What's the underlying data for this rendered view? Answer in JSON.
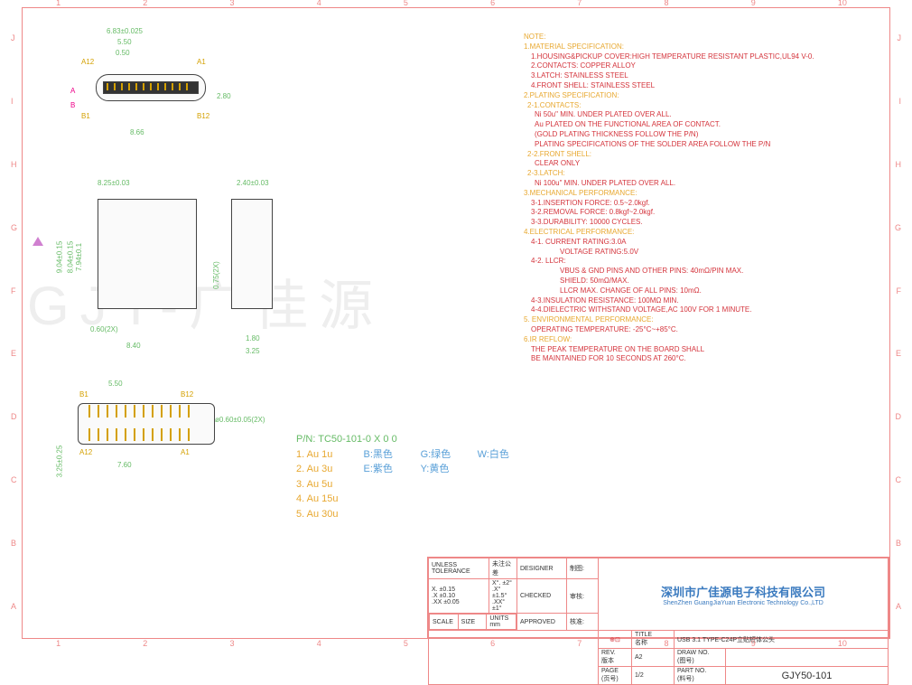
{
  "grid": {
    "cols": [
      "1",
      "2",
      "3",
      "4",
      "5",
      "6",
      "7",
      "8",
      "9",
      "10"
    ],
    "rows": [
      "J",
      "I",
      "H",
      "G",
      "F",
      "E",
      "D",
      "C",
      "B",
      "A"
    ]
  },
  "dims": {
    "d1": "6.83±0.025",
    "d2": "5.50",
    "d3": "0.50",
    "d4": "8.66",
    "d5": "2.80",
    "d6": "8.25±0.03",
    "d7": "2.40±0.03",
    "d8": "9.04±0.15",
    "d9": "8.04±0.15",
    "d10": "7.94±0.1",
    "d11": "0.60(2X)",
    "d12": "8.40",
    "d13": "0.75(2X)",
    "d14": "1.80",
    "d15": "3.25",
    "d16": "5.50",
    "d17": "ø0.60±0.05(2X)",
    "d18": "7.60",
    "d19": "3.25±0.25",
    "a1": "A1",
    "a12": "A12",
    "b1": "B1",
    "b12": "B12",
    "aA": "A",
    "aB": "B"
  },
  "notes": {
    "title": "NOTE:",
    "s1": "1.MATERIAL SPECIFICATION:",
    "s1_1": "1.HOUSING&PICKUP COVER:HIGH TEMPERATURE RESISTANT PLASTIC,UL94 V-0.",
    "s1_2": "2.CONTACTS: COPPER ALLOY",
    "s1_3": "3.LATCH: STAINLESS STEEL",
    "s1_4": "4.FRONT SHELL: STAINLESS STEEL",
    "s2": "2.PLATING SPECIFICATION:",
    "s2_1": "2-1.CONTACTS:",
    "s2_1a": "Ni 50u\" MIN. UNDER PLATED OVER ALL.",
    "s2_1b": "Au PLATED ON THE FUNCTIONAL AREA OF CONTACT.",
    "s2_1c": "(GOLD PLATING THICKNESS FOLLOW THE P/N)",
    "s2_1d": "PLATING SPECIFICATIONS OF THE SOLDER AREA FOLLOW THE P/N",
    "s2_2": "2-2.FRONT SHELL:",
    "s2_2a": "CLEAR ONLY",
    "s2_3": "2-3.LATCH:",
    "s2_3a": "Ni 100u\" MIN. UNDER PLATED OVER ALL.",
    "s3": "3.MECHANICAL PERFORMANCE:",
    "s3_1": "3-1.INSERTION FORCE: 0.5~2.0kgf.",
    "s3_2": "3-2.REMOVAL FORCE: 0.8kgf~2.0kgf.",
    "s3_3": "3-3.DURABILITY: 10000 CYCLES.",
    "s4": "4.ELECTRICAL PERFORMANCE:",
    "s4_1": "4-1. CURRENT RATING:3.0A",
    "s4_1a": "VOLTAGE RATING:5.0V",
    "s4_2": "4-2. LLCR:",
    "s4_2a": "VBUS & GND PINS AND OTHER PINS: 40mΩ/PIN MAX.",
    "s4_2b": "SHIELD: 50mΩ/MAX.",
    "s4_2c": "LLCR MAX. CHANGE OF ALL PINS: 10mΩ.",
    "s4_3": "4-3.INSULATION RESISTANCE: 100MΩ MIN.",
    "s4_4": "4-4.DIELECTRIC WITHSTAND VOLTAGE,AC 100V FOR 1 MINUTE.",
    "s5": "5. ENVIRONMENTAL PERFORMANCE:",
    "s5_1": "OPERATING TEMPERATURE: -25°C~+85°C.",
    "s6": "6.IR REFLOW:",
    "s6_1": "THE PEAK TEMPERATURE ON THE BOARD SHALL",
    "s6_2": "BE MAINTAINED FOR 10 SECONDS AT 260°C."
  },
  "pn": {
    "line": "P/N: TC50-101-0 X 0 0",
    "au": [
      "1. Au 1u",
      "2. Au 3u",
      "3. Au 5u",
      "4. Au 15u",
      "5. Au 30u"
    ],
    "colors": {
      "B": "B:黑色",
      "G": "G:绿色",
      "W": "W:白色",
      "E": "E:紫色",
      "Y": "Y:黄色"
    }
  },
  "titleblock": {
    "unless": "UNLESS TOLERANCE",
    "unless_cn": "未注公差",
    "t1": "X. ±0.15",
    "t1b": "X°. ±2°",
    "t2": ".X ±0.10",
    "t2b": ".X° ±1.5°",
    "t3": ".XX ±0.05",
    "t3b": ".XX° ±1°",
    "scale": "SCALE",
    "size": "SIZE",
    "units": "UNITS",
    "mm": "mm",
    "designer": "DESIGNER",
    "designer_cn": "制图:",
    "checked": "CHECKED",
    "checked_cn": "审核:",
    "approved": "APPROVED",
    "approved_cn": "核准:",
    "company_cn": "深圳市广佳源电子科技有限公司",
    "company_en": "ShenZhen GuangJiaYuan Electronic Technology Co.,LTD",
    "title_lbl": "TITLE",
    "title_cn": "名称",
    "title_val": "USB 3.1 TYPE-C24P立贴短体公头",
    "rev": "REV.",
    "rev_cn": "版本",
    "rev_val": "A2",
    "draw": "DRAW NO.",
    "draw_cn": "(图号)",
    "page": "PAGE",
    "page_cn": "(页号)",
    "page_val": "1/2",
    "part": "PART NO.",
    "part_cn": "(料号)",
    "part_val": "GJY50-101"
  },
  "watermark": "GJY-广佳源"
}
